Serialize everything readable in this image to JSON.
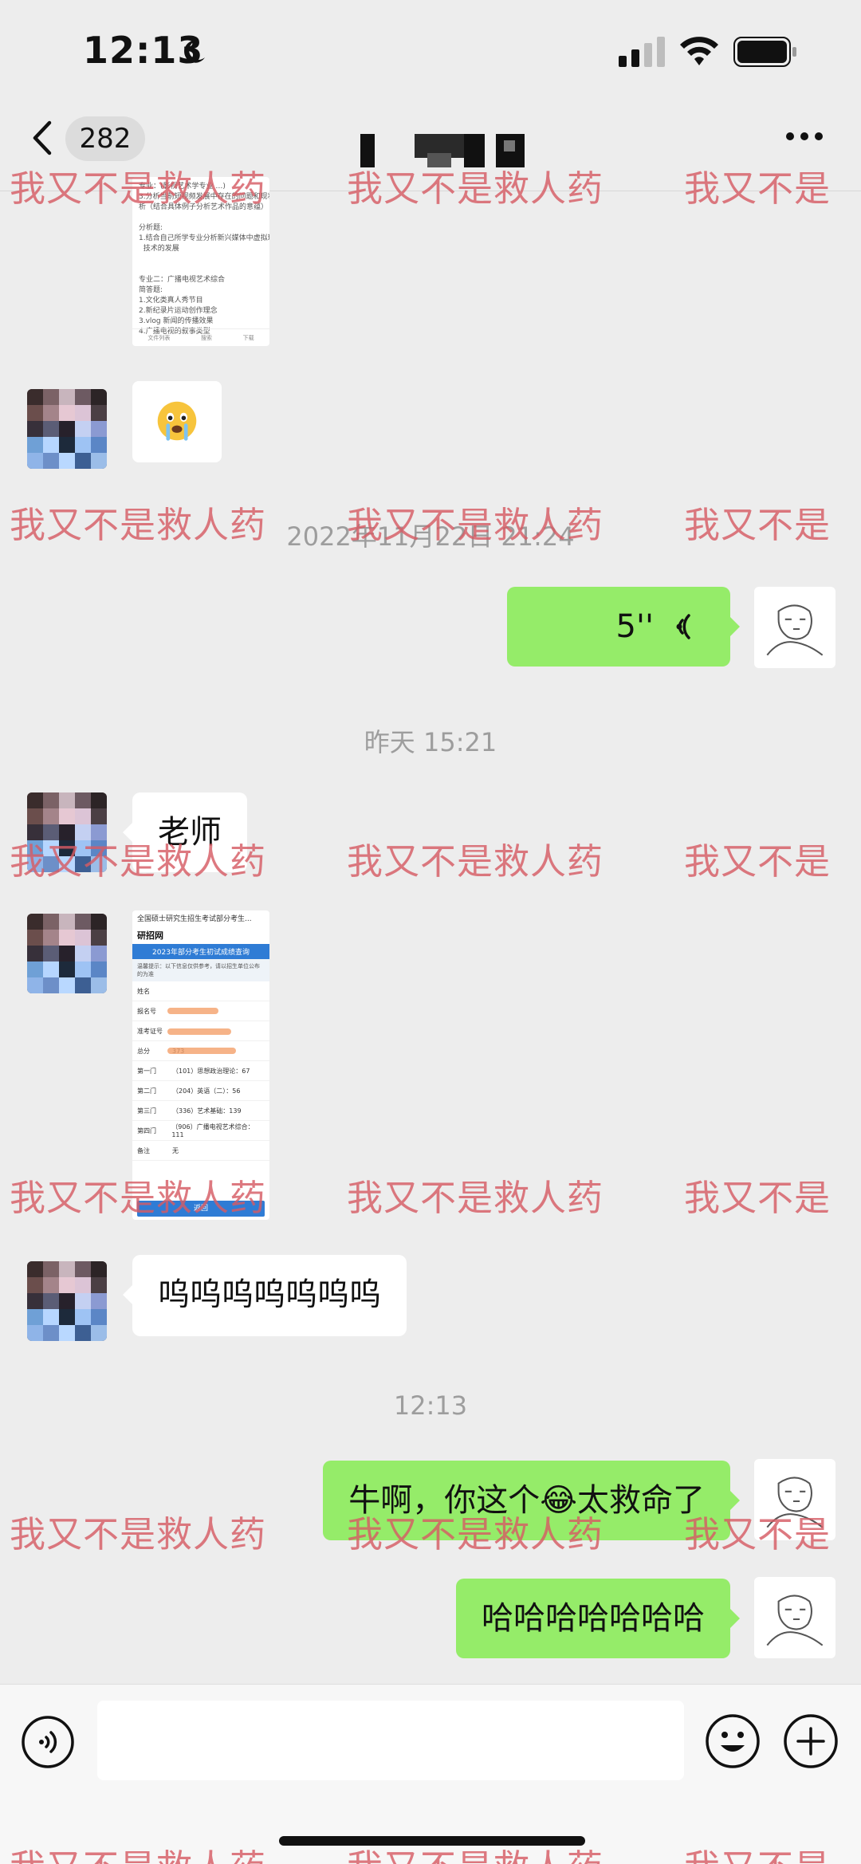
{
  "status_bar": {
    "time": "12:13"
  },
  "nav": {
    "unread_count": "282"
  },
  "messages": {
    "doc_preview": "专业：(影视艺术学专业 …)\n3.分析当前短视频发展中存在的问题和现状\n析（结合具体例子分析艺术作品的意蕴）\n\n分析题:\n1.结合自己所学专业分析新兴媒体中虚拟现实\n  技术的发展\n\n\n专业二：广播电视艺术综合\n简答题:\n1.文化类真人秀节目\n2.新纪录片运动创作理念\n3.vlog 新闻的传播效果\n4.广播电视的叙事类型",
    "doc_footer": [
      "文件列表",
      "搜索",
      "下载"
    ],
    "ts_1": "2022年11月22日 21:24",
    "voice_duration": "5''",
    "ts_2": "昨天 15:21",
    "text_1": "老师",
    "grade_card": {
      "top": "全国硕士研究生招生考试部分考生...",
      "site": "研招网",
      "banner": "2023年部分考生初试成绩查询",
      "note": "温馨提示：以下信息仅供参考，请以招生单位公布的为准",
      "rows": [
        {
          "label": "姓名",
          "value": ""
        },
        {
          "label": "报名号",
          "value": ""
        },
        {
          "label": "准考证号",
          "value": ""
        },
        {
          "label": "总分",
          "value": "373"
        },
        {
          "label": "第一门",
          "value": "（101）思想政治理论：67"
        },
        {
          "label": "第二门",
          "value": "（204）英语（二）：56"
        },
        {
          "label": "第三门",
          "value": "（336）艺术基础：139"
        },
        {
          "label": "第四门",
          "value": "（906）广播电视艺术综合：111"
        },
        {
          "label": "备注",
          "value": "无"
        }
      ],
      "button": "返回"
    },
    "text_2": "呜呜呜呜呜呜呜",
    "ts_3": "12:13",
    "text_3": "牛啊，你这个😂太救命了",
    "text_4": "哈哈哈哈哈哈哈"
  },
  "watermark": {
    "text": "我又不是救人药",
    "text_cut": "我又不是"
  },
  "input": {
    "placeholder": ""
  },
  "colors": {
    "background": "#ededed",
    "outgoing_bubble": "#95ec69",
    "incoming_bubble": "#ffffff",
    "watermark": "#d65c64"
  },
  "icons": [
    "moon-icon",
    "signal-icon",
    "wifi-icon",
    "battery-icon",
    "back-icon",
    "more-icon",
    "voice-wave-icon",
    "voice-toggle-icon",
    "emoji-icon",
    "plus-icon"
  ]
}
